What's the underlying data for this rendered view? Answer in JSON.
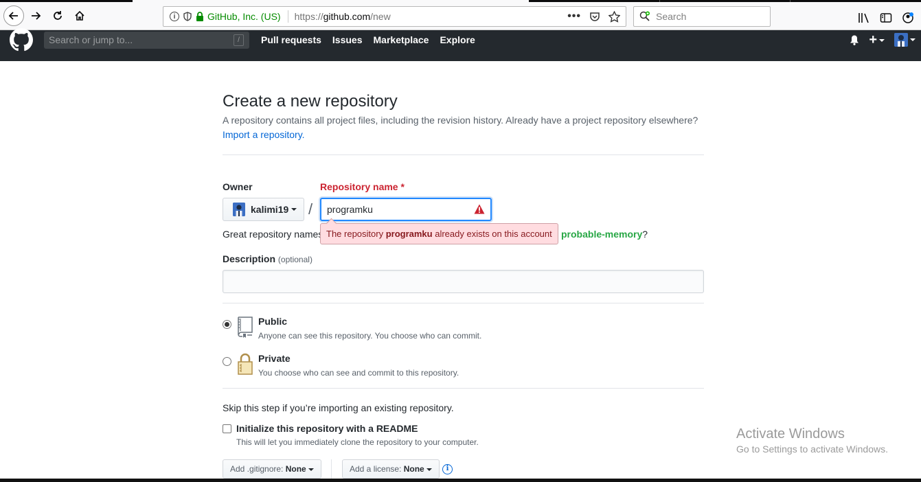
{
  "browser": {
    "url_org": "GitHub, Inc. (US)",
    "url_proto": "https://",
    "url_host": "github.com",
    "url_path": "/new",
    "search_placeholder": "Search"
  },
  "gh_header": {
    "search_placeholder": "Search or jump to...",
    "search_shortcut": "/",
    "nav": [
      "Pull requests",
      "Issues",
      "Marketplace",
      "Explore"
    ],
    "plus": "+"
  },
  "page": {
    "title": "Create a new repository",
    "subhead": "A repository contains all project files, including the revision history. Already have a project repository elsewhere?",
    "import_link": "Import a repository."
  },
  "form": {
    "owner_label": "Owner",
    "owner_value": "kalimi19",
    "repo_label": "Repository name *",
    "repo_value": "programku",
    "separator": "/",
    "hint_text": "Great repository names",
    "suggestion": "probable-memory",
    "suggestion_suffix": "?",
    "error_prefix": "The repository ",
    "error_repo": "programku",
    "error_suffix": " already exists on this account",
    "description_label": "Description",
    "description_optional": "(optional)",
    "description_value": ""
  },
  "visibility": {
    "selected": "public",
    "public_title": "Public",
    "public_desc": "Anyone can see this repository. You choose who can commit.",
    "private_title": "Private",
    "private_desc": "You choose who can see and commit to this repository."
  },
  "init": {
    "skip_text": "Skip this step if you’re importing an existing repository.",
    "readme_label": "Initialize this repository with a README",
    "readme_desc": "This will let you immediately clone the repository to your computer.",
    "readme_checked": false,
    "gitignore_prefix": "Add .gitignore: ",
    "gitignore_value": "None",
    "license_prefix": "Add a license: ",
    "license_value": "None"
  },
  "watermark": {
    "line1": "Activate Windows",
    "line2": "Go to Settings to activate Windows."
  },
  "colors": {
    "header_bg": "#24292e",
    "error_red": "#cb2431",
    "error_popup_bg": "#ffdce0",
    "link_blue": "#0366d6",
    "focus_blue": "#2188ff",
    "suggestion_green": "#28a745",
    "secure_green": "#058b00"
  }
}
